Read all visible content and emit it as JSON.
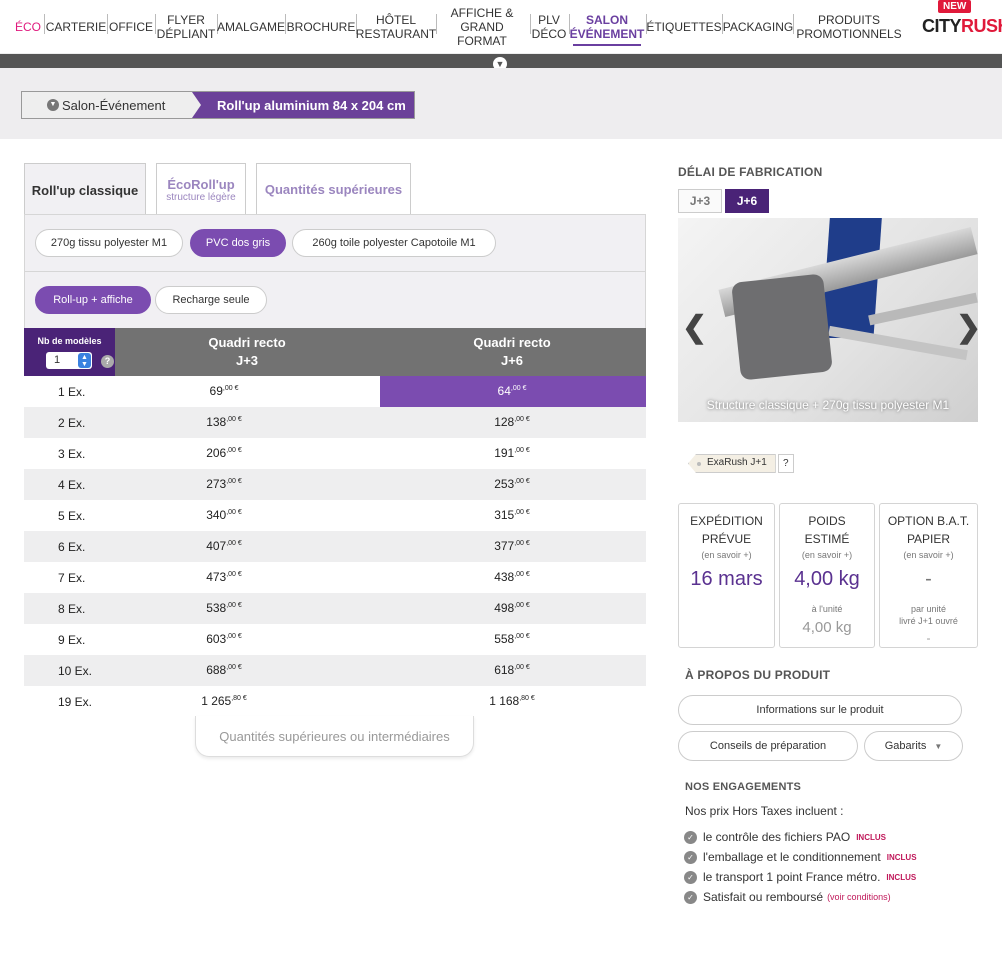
{
  "nav": {
    "items": [
      "ÉCO",
      "CARTERIE",
      "OFFICE",
      "FLYER\nDÉPLIANT",
      "AMALGAME",
      "BROCHURE",
      "HÔTEL\nRESTAURANT",
      "AFFICHE &\nGRAND FORMAT",
      "PLV\nDÉCO",
      "SALON\nÉVÉNEMENT",
      "ÉTIQUETTES",
      "PACKAGING",
      "PRODUITS\nPROMOTIONNELS"
    ],
    "logo_badge": "NEW",
    "logo_city": "CITY",
    "logo_rush": "RUSH",
    "accent": "#6a3fa0"
  },
  "breadcrumb": {
    "parent": "Salon-Événement",
    "current": "Roll'up aluminium 84 x 204 cm"
  },
  "tabs": [
    {
      "title": "Roll'up classique",
      "sub": ""
    },
    {
      "title": "ÉcoRoll'up",
      "sub": "structure légère"
    },
    {
      "title": "Quantités supérieures",
      "sub": ""
    }
  ],
  "materials": [
    "270g tissu polyester M1",
    "PVC dos gris",
    "260g toile polyester Capotoile M1"
  ],
  "options": [
    "Roll-up + affiche",
    "Recharge seule"
  ],
  "table": {
    "nb_label": "Nb de modèles",
    "nb_value": "1",
    "help": "?",
    "col1": "Quadri recto\nJ+3",
    "col2": "Quadri recto\nJ+6",
    "rows": [
      {
        "q": "1 Ex.",
        "a": "69",
        "ac": ",00 €",
        "b": "64",
        "bc": ",00 €"
      },
      {
        "q": "2 Ex.",
        "a": "138",
        "ac": ",00 €",
        "b": "128",
        "bc": ",00 €"
      },
      {
        "q": "3 Ex.",
        "a": "206",
        "ac": ",00 €",
        "b": "191",
        "bc": ",00 €"
      },
      {
        "q": "4 Ex.",
        "a": "273",
        "ac": ",00 €",
        "b": "253",
        "bc": ",00 €"
      },
      {
        "q": "5 Ex.",
        "a": "340",
        "ac": ",00 €",
        "b": "315",
        "bc": ",00 €"
      },
      {
        "q": "6 Ex.",
        "a": "407",
        "ac": ",00 €",
        "b": "377",
        "bc": ",00 €"
      },
      {
        "q": "7 Ex.",
        "a": "473",
        "ac": ",00 €",
        "b": "438",
        "bc": ",00 €"
      },
      {
        "q": "8 Ex.",
        "a": "538",
        "ac": ",00 €",
        "b": "498",
        "bc": ",00 €"
      },
      {
        "q": "9 Ex.",
        "a": "603",
        "ac": ",00 €",
        "b": "558",
        "bc": ",00 €"
      },
      {
        "q": "10 Ex.",
        "a": "688",
        "ac": ",00 €",
        "b": "618",
        "bc": ",00 €"
      },
      {
        "q": "19 Ex.",
        "a": "1 265",
        "ac": ",80 €",
        "b": "1 168",
        "bc": ",80 €"
      }
    ],
    "more_button": "Quantités supérieures ou intermédiaires"
  },
  "delay": {
    "title": "DÉLAI DE FABRICATION",
    "opts": [
      "J+3",
      "J+6"
    ]
  },
  "photo": {
    "caption": "Structure classique + 270g tissu polyester M1",
    "prev": "❮",
    "next": "❯"
  },
  "exarush": {
    "label": "ExaRush J+1",
    "help": "?"
  },
  "info": [
    {
      "title": "EXPÉDITION\nPRÉVUE",
      "link": "(en savoir +)",
      "value": "16 mars"
    },
    {
      "title": "POIDS\nESTIMÉ",
      "link": "(en savoir +)",
      "value": "4,00 kg",
      "unit_note": "à l'unité",
      "unit_value": "4,00 kg"
    },
    {
      "title": "OPTION B.A.T.\nPAPIER",
      "link": "(en savoir +)",
      "value": "-",
      "unit_note": "par unité\nlivré J+1 ouvré",
      "unit_value": "-"
    }
  ],
  "about": {
    "title": "À PROPOS DU PRODUIT",
    "info_btn": "Informations sur le produit",
    "prep_btn": "Conseils de préparation",
    "gabarits_btn": "Gabarits"
  },
  "engagements": {
    "title": "NOS ENGAGEMENTS",
    "intro": "Nos prix Hors Taxes incluent :",
    "items": [
      {
        "text": "le contrôle des fichiers PAO",
        "tag": "INCLUS"
      },
      {
        "text": "l'emballage et le conditionnement",
        "tag": "INCLUS"
      },
      {
        "text": "le transport 1 point France métro.",
        "tag": "INCLUS"
      },
      {
        "text": "Satisfait ou remboursé",
        "tag": "(voir conditions)"
      }
    ]
  }
}
